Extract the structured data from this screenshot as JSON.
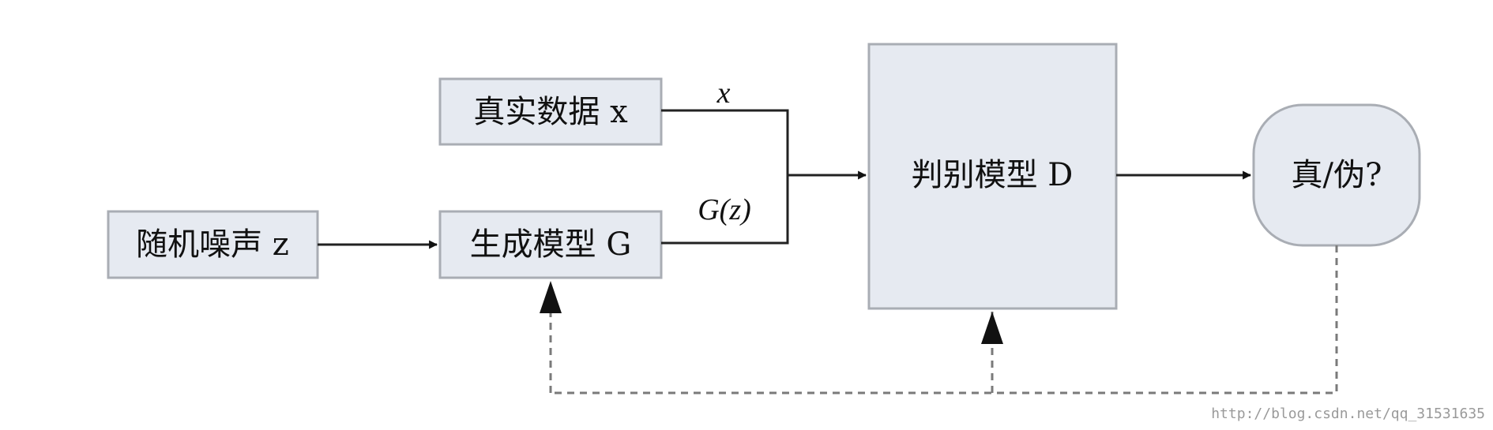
{
  "nodes": {
    "real_data": "真实数据 x",
    "random_noise": "随机噪声 z",
    "generator": "生成模型 G",
    "discriminator": "判别模型 D",
    "output": "真/伪?"
  },
  "edge_labels": {
    "x": "x",
    "gz": "G(z)"
  },
  "watermark": "http://blog.csdn.net/qq_31531635",
  "colors": {
    "box_fill": "#e6eaf1",
    "box_stroke": "#a9adb4",
    "line": "#222222",
    "dashed": "#7a7a7a"
  }
}
